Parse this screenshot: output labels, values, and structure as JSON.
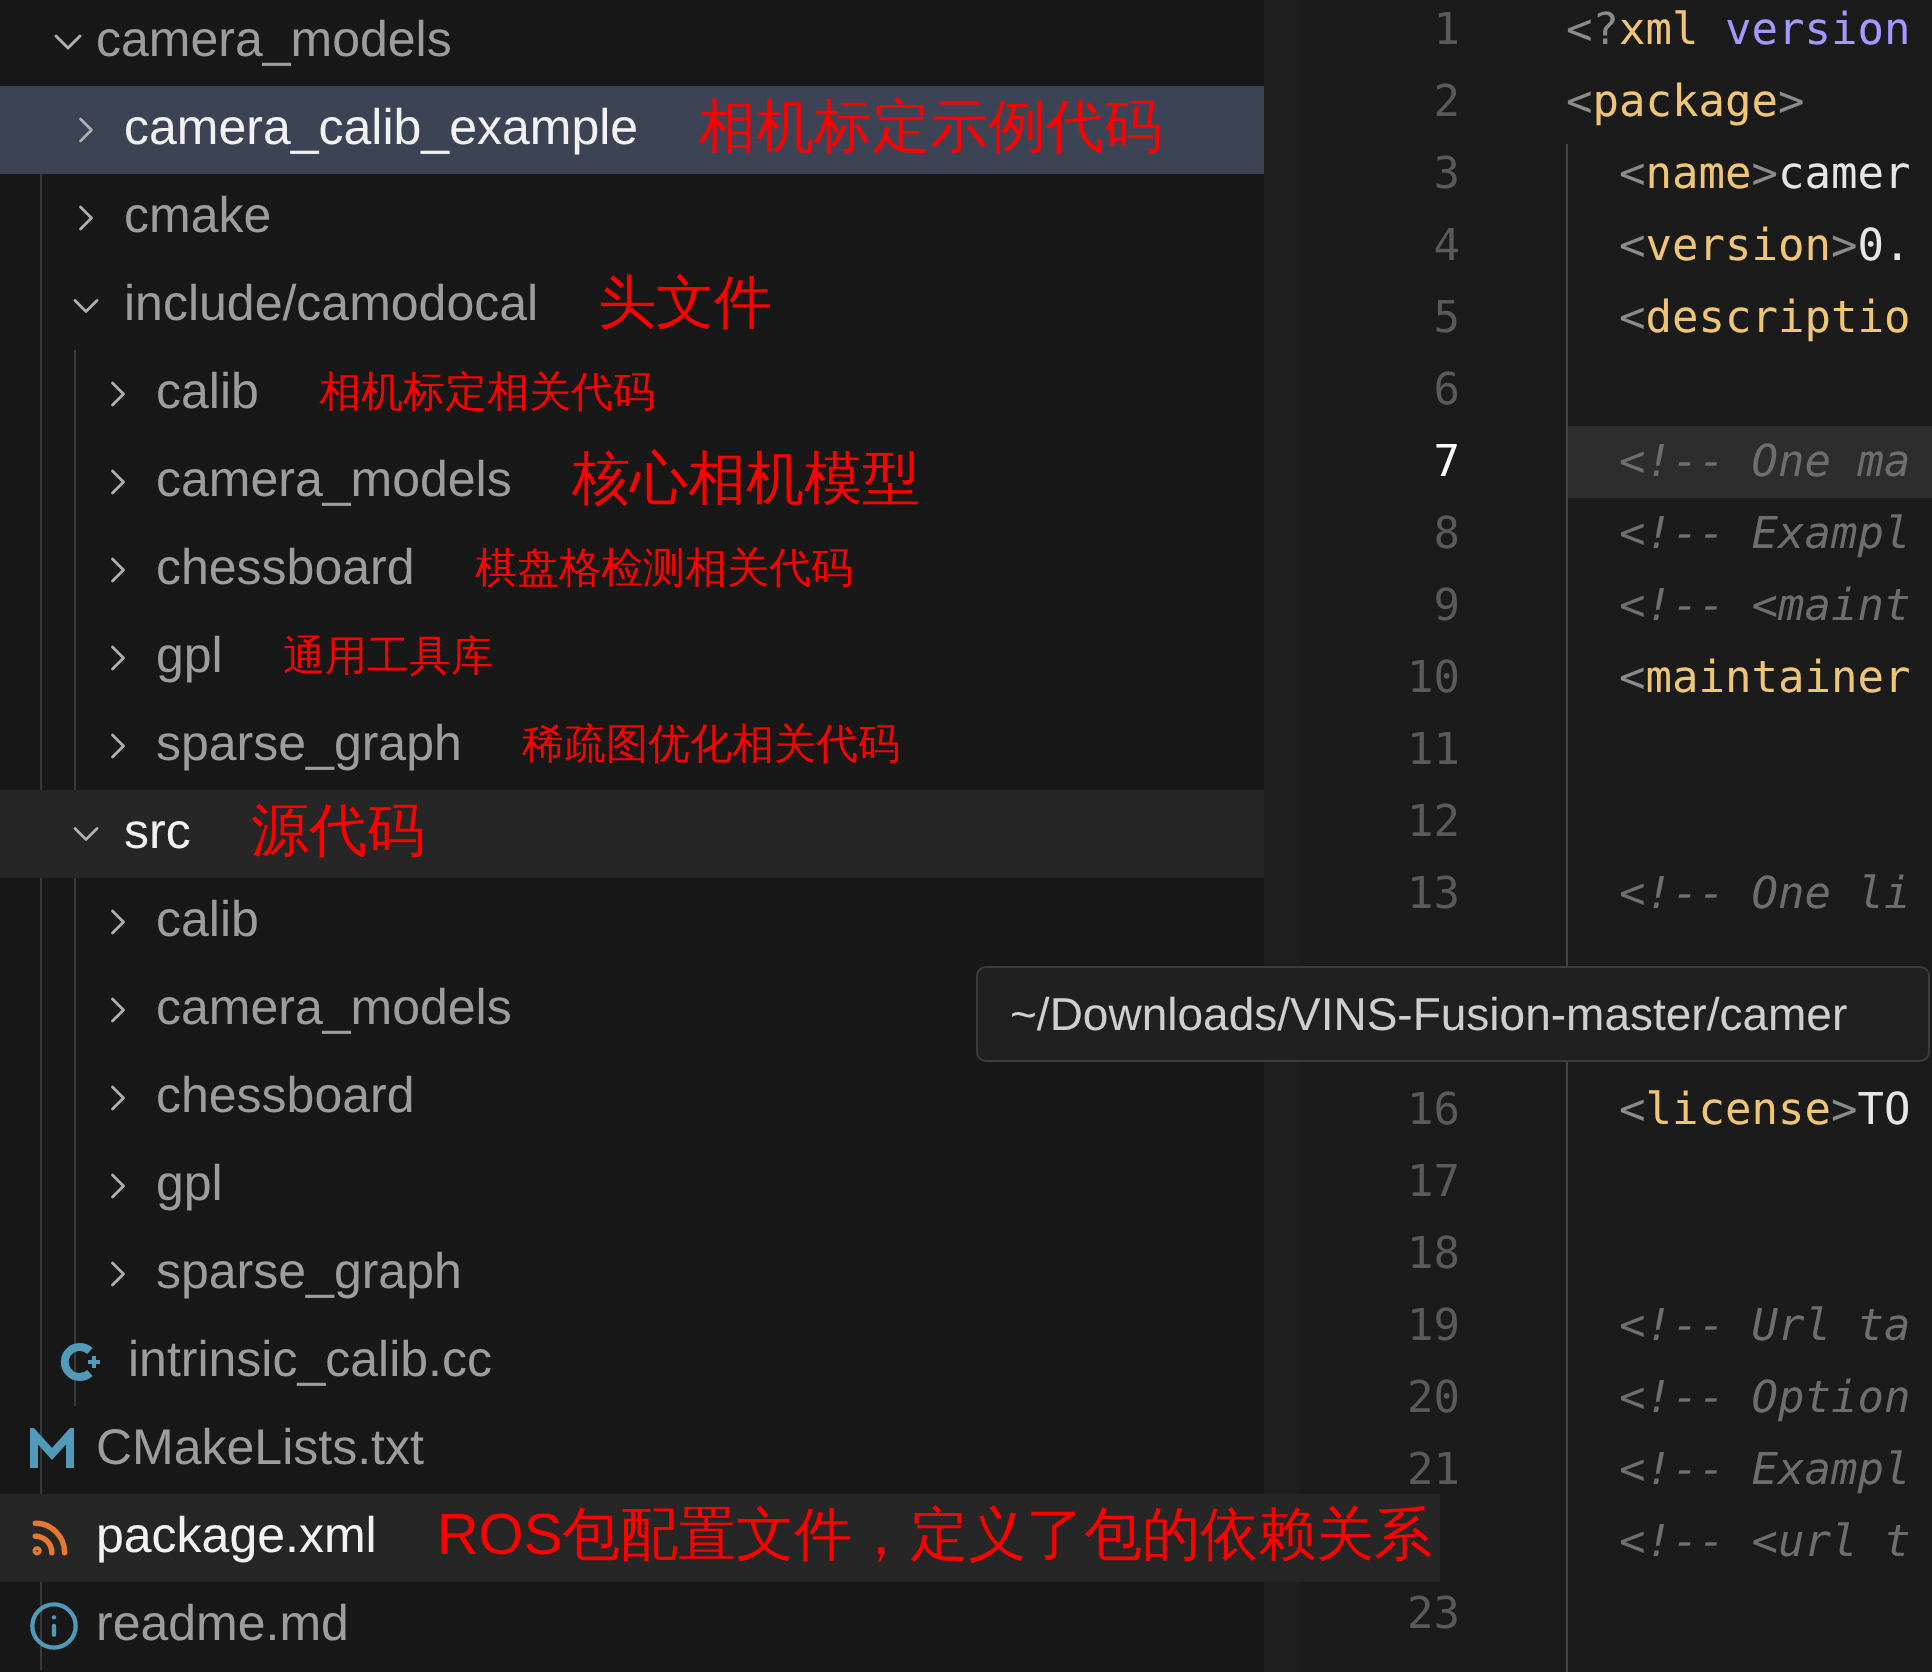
{
  "explorer": {
    "root": {
      "label": "camera_models",
      "expanded": true
    },
    "items": [
      {
        "kind": "folder",
        "label": "camera_calib_example",
        "expanded": false,
        "selected": true,
        "hovered": false,
        "note": {
          "text": "相机标定示例代码",
          "large": true
        }
      },
      {
        "kind": "folder",
        "label": "cmake",
        "expanded": false,
        "selected": false,
        "hovered": false
      },
      {
        "kind": "folder",
        "label": "include/camodocal",
        "expanded": true,
        "selected": false,
        "hovered": false,
        "note": {
          "text": "头文件",
          "large": true
        },
        "children": [
          {
            "kind": "folder",
            "label": "calib",
            "expanded": false,
            "selected": false,
            "hovered": false,
            "note": {
              "text": "相机标定相关代码",
              "large": false
            }
          },
          {
            "kind": "folder",
            "label": "camera_models",
            "expanded": false,
            "selected": false,
            "hovered": false,
            "note": {
              "text": "核心相机模型",
              "large": true
            }
          },
          {
            "kind": "folder",
            "label": "chessboard",
            "expanded": false,
            "selected": false,
            "hovered": false,
            "note": {
              "text": "棋盘格检测相关代码",
              "large": false
            }
          },
          {
            "kind": "folder",
            "label": "gpl",
            "expanded": false,
            "selected": false,
            "hovered": false,
            "note": {
              "text": "通用工具库",
              "large": false
            }
          },
          {
            "kind": "folder",
            "label": "sparse_graph",
            "expanded": false,
            "selected": false,
            "hovered": false,
            "note": {
              "text": "稀疏图优化相关代码",
              "large": false
            }
          }
        ]
      },
      {
        "kind": "folder",
        "label": "src",
        "expanded": true,
        "selected": false,
        "hovered": true,
        "note": {
          "text": "源代码",
          "large": true
        },
        "children": [
          {
            "kind": "folder",
            "label": "calib",
            "expanded": false,
            "selected": false,
            "hovered": false
          },
          {
            "kind": "folder",
            "label": "camera_models",
            "expanded": false,
            "selected": false,
            "hovered": false
          },
          {
            "kind": "folder",
            "label": "chessboard",
            "expanded": false,
            "selected": false,
            "hovered": false
          },
          {
            "kind": "folder",
            "label": "gpl",
            "expanded": false,
            "selected": false,
            "hovered": false
          },
          {
            "kind": "folder",
            "label": "sparse_graph",
            "expanded": false,
            "selected": false,
            "hovered": false
          },
          {
            "kind": "cpp",
            "label": "intrinsic_calib.cc",
            "selected": false,
            "hovered": false
          }
        ]
      },
      {
        "kind": "cmake",
        "label": "CMakeLists.txt",
        "selected": false,
        "hovered": false
      },
      {
        "kind": "rss",
        "label": "package.xml",
        "selected": false,
        "hovered": true,
        "note": {
          "text": "ROS包配置文件，定义了包的依赖关系",
          "large": true
        }
      },
      {
        "kind": "info",
        "label": "readme.md",
        "selected": false,
        "hovered": false
      }
    ]
  },
  "editor": {
    "lines": [
      {
        "kind": "code",
        "number": "1",
        "current": false,
        "segments": [
          {
            "kind": "punct",
            "text": "<?"
          },
          {
            "kind": "tag",
            "text": "xml"
          },
          {
            "kind": "attr",
            "text": " version"
          }
        ]
      },
      {
        "kind": "code",
        "number": "2",
        "current": false,
        "segments": [
          {
            "kind": "punct",
            "text": "<"
          },
          {
            "kind": "tag",
            "text": "package"
          },
          {
            "kind": "punct",
            "text": ">"
          }
        ]
      },
      {
        "kind": "code",
        "number": "3",
        "current": false,
        "segments": [
          {
            "kind": "punct",
            "text": "  <"
          },
          {
            "kind": "tag",
            "text": "name"
          },
          {
            "kind": "punct",
            "text": ">"
          },
          {
            "kind": "text",
            "text": "camer"
          }
        ]
      },
      {
        "kind": "code",
        "number": "4",
        "current": false,
        "segments": [
          {
            "kind": "punct",
            "text": "  <"
          },
          {
            "kind": "tag",
            "text": "version"
          },
          {
            "kind": "punct",
            "text": ">"
          },
          {
            "kind": "text",
            "text": "0."
          }
        ]
      },
      {
        "kind": "code",
        "number": "5",
        "current": false,
        "segments": [
          {
            "kind": "punct",
            "text": "  <"
          },
          {
            "kind": "tag",
            "text": "descriptio"
          }
        ]
      },
      {
        "kind": "code",
        "number": "6",
        "current": false
      },
      {
        "kind": "code",
        "number": "7",
        "current": true,
        "segments": [
          {
            "kind": "comment",
            "text": "  <!-- One ma"
          }
        ]
      },
      {
        "kind": "code",
        "number": "8",
        "current": false,
        "segments": [
          {
            "kind": "comment",
            "text": "  <!-- Exampl"
          }
        ]
      },
      {
        "kind": "code",
        "number": "9",
        "current": false,
        "segments": [
          {
            "kind": "comment",
            "text": "  <!-- <maint"
          }
        ]
      },
      {
        "kind": "code",
        "number": "10",
        "current": false,
        "segments": [
          {
            "kind": "punct",
            "text": "  <"
          },
          {
            "kind": "tag",
            "text": "maintainer"
          }
        ]
      },
      {
        "kind": "code",
        "number": "11",
        "current": false
      },
      {
        "kind": "code",
        "number": "12",
        "current": false
      },
      {
        "kind": "code",
        "number": "13",
        "current": false,
        "segments": [
          {
            "kind": "comment",
            "text": "  <!-- One li"
          }
        ]
      },
      {
        "kind": "covered"
      },
      {
        "kind": "covered"
      },
      {
        "kind": "code",
        "number": "16",
        "current": false,
        "segments": [
          {
            "kind": "punct",
            "text": "  <"
          },
          {
            "kind": "tag",
            "text": "license"
          },
          {
            "kind": "punct",
            "text": ">"
          },
          {
            "kind": "text",
            "text": "TO"
          }
        ]
      },
      {
        "kind": "code",
        "number": "17",
        "current": false
      },
      {
        "kind": "code",
        "number": "18",
        "current": false
      },
      {
        "kind": "code",
        "number": "19",
        "current": false,
        "segments": [
          {
            "kind": "comment",
            "text": "  <!-- Url ta"
          }
        ]
      },
      {
        "kind": "code",
        "number": "20",
        "current": false,
        "segments": [
          {
            "kind": "comment",
            "text": "  <!-- Option"
          }
        ]
      },
      {
        "kind": "code",
        "number": "21",
        "current": false,
        "segments": [
          {
            "kind": "comment",
            "text": "  <!-- Exampl"
          }
        ]
      },
      {
        "kind": "code",
        "current": false,
        "segments": [
          {
            "kind": "comment",
            "text": "  <!-- <url t"
          }
        ]
      },
      {
        "kind": "code",
        "number": "23",
        "current": false
      }
    ]
  },
  "tooltip": {
    "text": "~/Downloads/VINS-Fusion-master/camer"
  }
}
